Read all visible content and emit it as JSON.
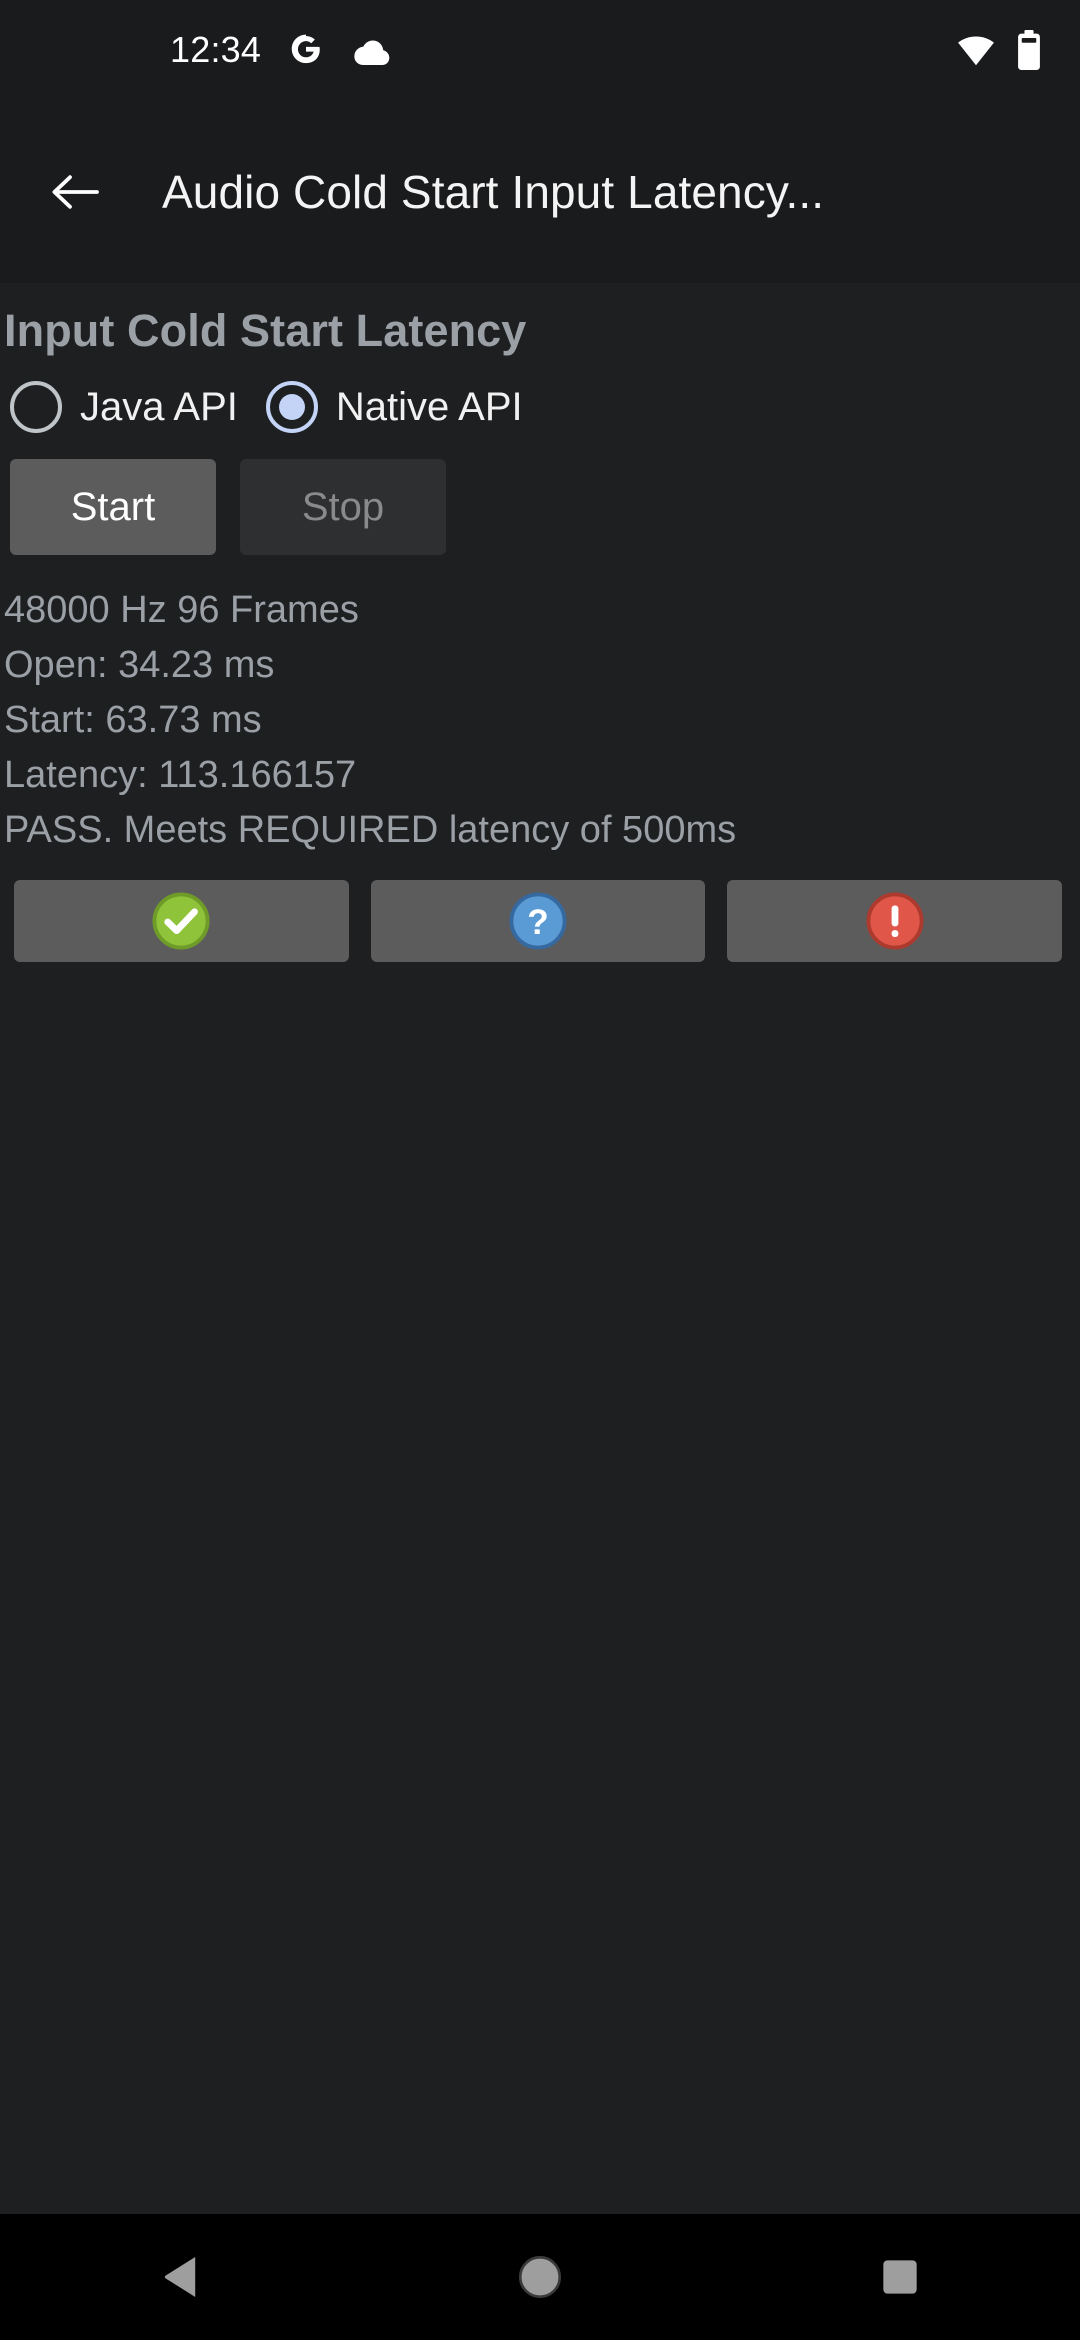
{
  "status_bar": {
    "clock": "12:34",
    "icons_left": [
      "google-g-icon",
      "cloud-icon"
    ],
    "icons_right": [
      "wifi-icon",
      "battery-icon"
    ]
  },
  "app_bar": {
    "back_icon": "back-arrow-icon",
    "title": "Audio Cold Start Input Latency..."
  },
  "main": {
    "heading": "Input Cold Start Latency",
    "radios": [
      {
        "label": "Java API",
        "checked": false
      },
      {
        "label": "Native API",
        "checked": true
      }
    ],
    "buttons": [
      {
        "label": "Start",
        "enabled": true
      },
      {
        "label": "Stop",
        "enabled": false
      }
    ],
    "results": [
      "48000 Hz 96 Frames",
      "Open: 34.23 ms",
      "Start: 63.73 ms",
      "Latency: 113.166157",
      "PASS. Meets REQUIRED latency of 500ms"
    ],
    "status_buttons": [
      {
        "icon": "pass-check-icon",
        "glyph": "✔",
        "color": "#8fc33a",
        "border": "#6f9c28"
      },
      {
        "icon": "info-question-icon",
        "glyph": "?",
        "color": "#5b9bd5",
        "border": "#35699f"
      },
      {
        "icon": "fail-exclamation-icon",
        "glyph": "!",
        "color": "#e0574a",
        "border": "#ad3a2e"
      }
    ]
  },
  "nav_bar": {
    "back": "nav-back-icon",
    "home": "nav-home-icon",
    "recent": "nav-recents-icon"
  },
  "colors": {
    "background": "#1e1f21",
    "app_bar": "#1a1b1d",
    "nav_bar": "#000000",
    "text_primary": "#f4f4f4",
    "text_secondary": "#9aa0a6",
    "accent_radio": "#c3d4f7",
    "button_enabled": "#5c5c5c",
    "button_disabled": "#2e2f31"
  }
}
